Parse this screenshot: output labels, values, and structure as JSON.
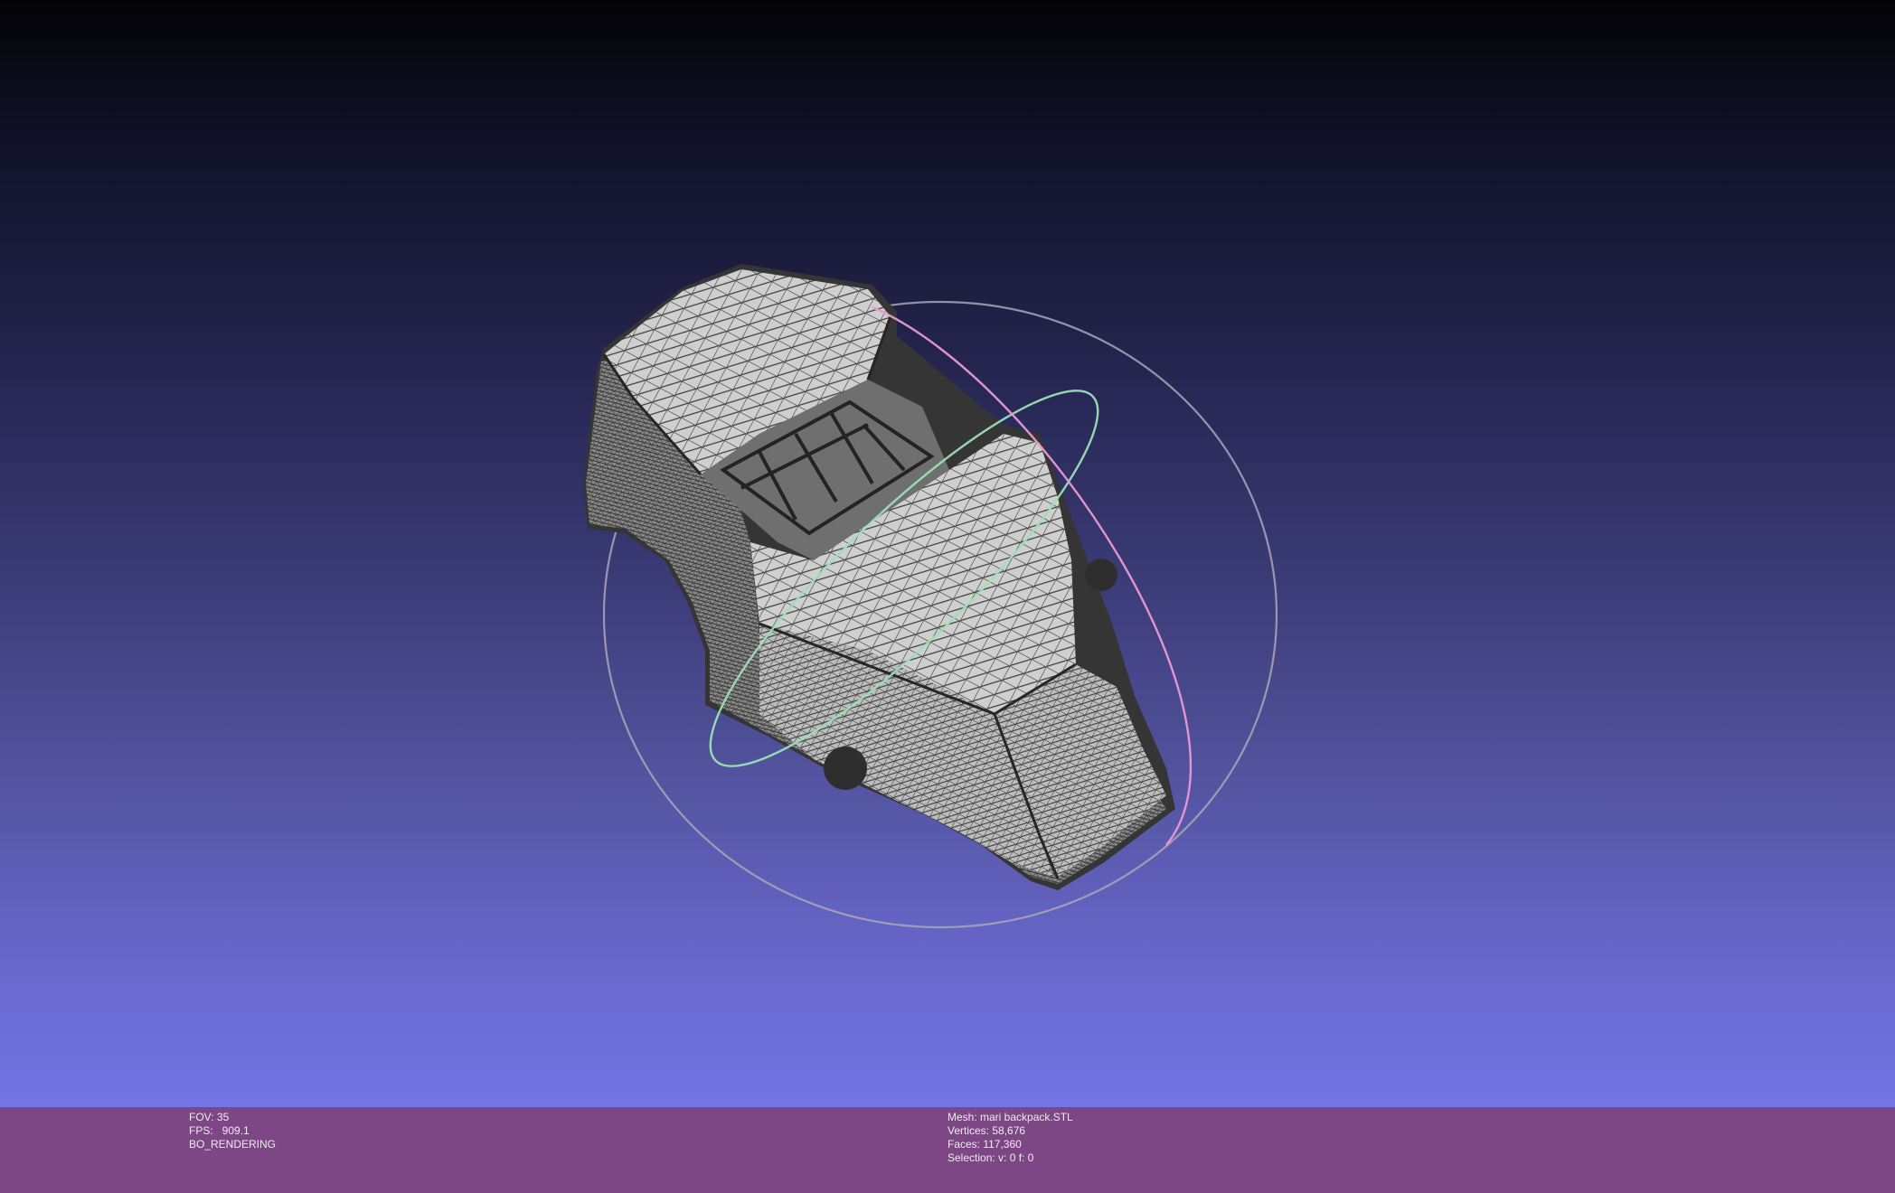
{
  "viewer": {
    "colors": {
      "background_top": "#030306",
      "background_bottom": "#7474e6",
      "status_bar": "#7d4684",
      "mesh_fill": "#c9c9c9",
      "mesh_wire": "#3a3a3a",
      "trackball_x": "#e99ad0",
      "trackball_y": "#9be0b4",
      "trackball_z": "#b8b8c8"
    },
    "model_icon": "wireframe-mesh",
    "trackball_icon": "trackball-rings"
  },
  "status": {
    "fov": "FOV: 35",
    "fps": "FPS:   909.1",
    "render_mode": "BO_RENDERING",
    "mesh": "Mesh: mari backpack.STL",
    "vertices": "Vertices: 58,676",
    "faces": "Faces: 117,360",
    "selection": "Selection: v: 0 f: 0"
  }
}
